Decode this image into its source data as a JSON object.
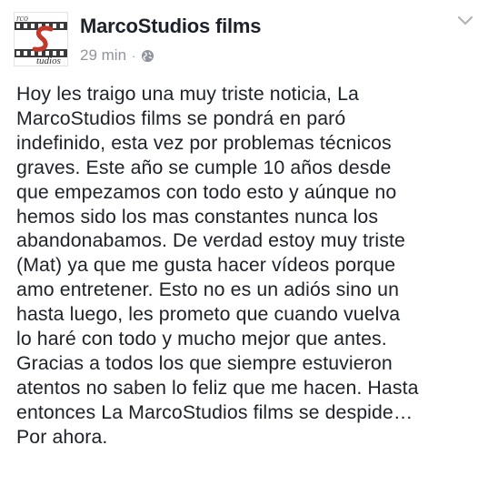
{
  "post": {
    "author": {
      "name": "MarcoStudios films",
      "avatar_text": "tudios",
      "avatar_top_text": "rco"
    },
    "timestamp": "29 min",
    "separator": "·",
    "audience_icon": "globe-icon",
    "menu_icon": "chevron-down-icon",
    "text": "Hoy les traigo una muy triste noticia, La\nMarcoStudios films se pondrá en paró\nindefinido, esta vez por problemas técnicos\ngraves. Este año se cumple 10 años desde\nque empezamos con todo esto y aúnque no\nhemos sido los mas constantes nunca los\nabandonabamos. De verdad estoy muy triste\n(Mat) ya que me gusta hacer vídeos porque\namo entretener. Esto no es un adiós sino un\nhasta luego, les prometo que cuando vuelva\nlo haré con todo y mucho mejor que antes.\nGracias a todos los que siempre estuvieron\natentos no saben lo feliz que me hacen. Hasta\nentonces La MarcoStudios films se despide…\nPor ahora."
  },
  "colors": {
    "text_primary": "#1d2129",
    "text_secondary": "#90949c",
    "logo_red": "#c0392b"
  }
}
